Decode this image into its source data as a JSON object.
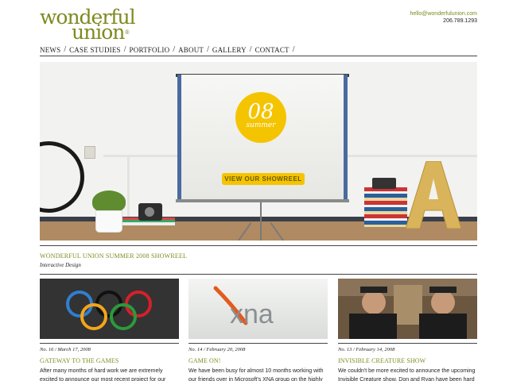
{
  "brand": {
    "logo_line1": "wonderful",
    "logo_line2": "union",
    "logo_reg": "®"
  },
  "contact": {
    "email": "hello@wonderfulunion.com",
    "phone": "206.789.1293"
  },
  "nav": {
    "items": [
      "NEWS",
      "CASE STUDIES",
      "PORTFOLIO",
      "ABOUT",
      "GALLERY",
      "CONTACT"
    ],
    "separator": "/"
  },
  "hero": {
    "badge_number": "08",
    "badge_text": "summer",
    "button_label": "VIEW OUR SHOWREEL",
    "letter": "A"
  },
  "feature": {
    "title": "WONDERFUL UNION SUMMER 2008 SHOWREEL",
    "subtitle": "Interactive Design"
  },
  "cards": [
    {
      "meta": "No. 16 / March 17, 2008",
      "title": "GATEWAY TO THE GAMES",
      "body": "After many months of hard work we are extremely excited to announce our most recent project for our friends at"
    },
    {
      "meta": "No. 14 / February 20, 2008",
      "title": "GAME ON!",
      "body": "We have been busy for almost 10 months working with our friends over in Microsoft's XNA group on the highly",
      "thumb_text": "xna"
    },
    {
      "meta": "No. 13 / February 14, 2008",
      "title": "INVISIBLE CREATURE SHOW",
      "body": "We couldn't be more excited to announce the upcoming Invisible Creature show. Don and Ryan have been hard"
    }
  ],
  "colors": {
    "brand_green": "#7e8a1f",
    "accent_yellow": "#f5c400",
    "rule": "#444444"
  }
}
